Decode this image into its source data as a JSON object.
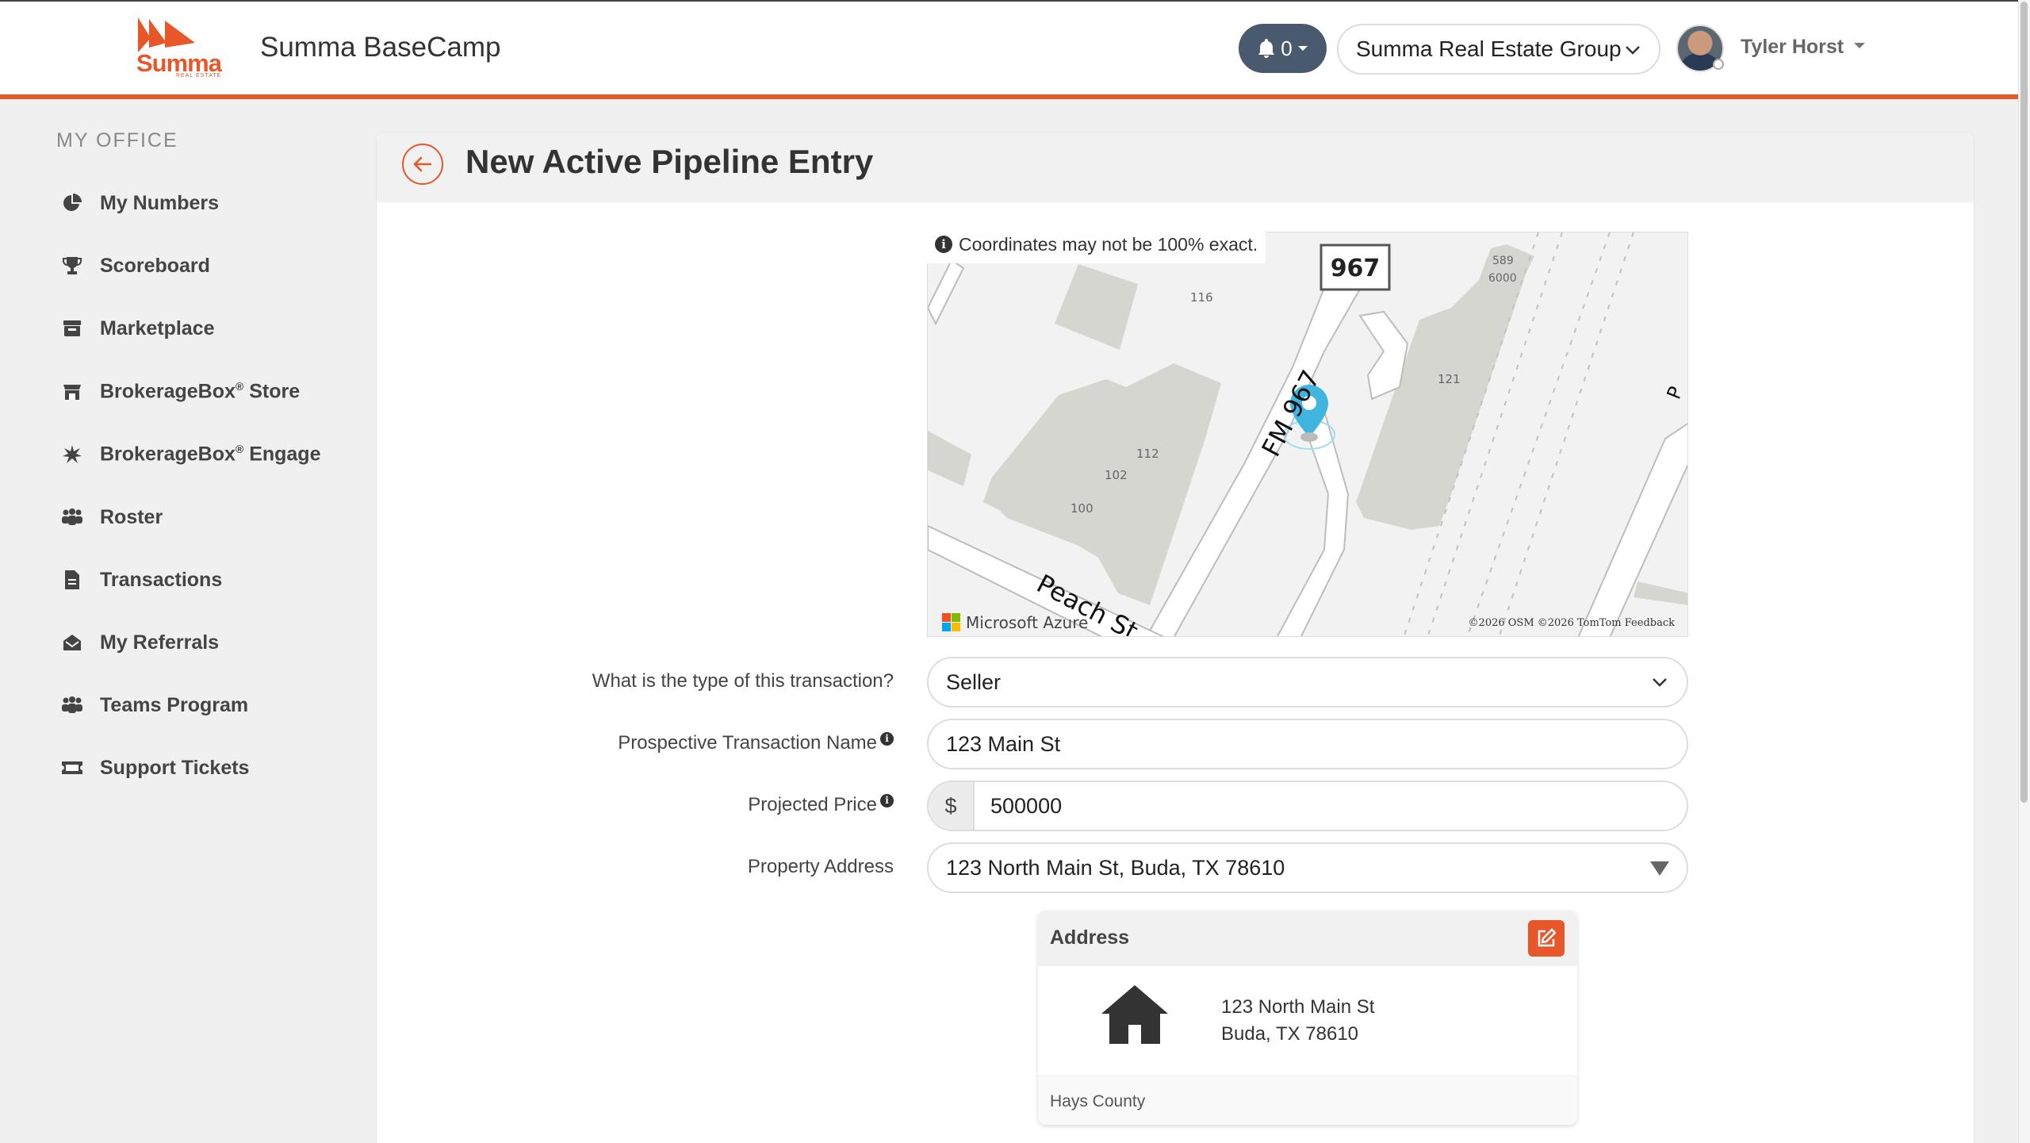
{
  "header": {
    "logo_word": "Summa",
    "logo_sub": "REAL ESTATE",
    "app_title": "Summa BaseCamp",
    "notification_count": "0",
    "org_name": "Summa Real Estate Group",
    "user_name": "Tyler Horst"
  },
  "sidebar": {
    "heading": "MY OFFICE",
    "items": [
      {
        "label": "My Numbers",
        "icon": "pie-chart-icon"
      },
      {
        "label": "Scoreboard",
        "icon": "trophy-icon"
      },
      {
        "label": "Marketplace",
        "icon": "store-icon"
      },
      {
        "label": "BrokerageBox",
        "suffix": "Store",
        "icon": "storefront-icon"
      },
      {
        "label": "BrokerageBox",
        "suffix": "Engage",
        "icon": "burst-icon"
      },
      {
        "label": "Roster",
        "icon": "people-icon"
      },
      {
        "label": "Transactions",
        "icon": "document-icon"
      },
      {
        "label": "My Referrals",
        "icon": "envelope-open-icon"
      },
      {
        "label": "Teams Program",
        "icon": "people-icon"
      },
      {
        "label": "Support Tickets",
        "icon": "ticket-icon"
      }
    ],
    "registered_mark": "®"
  },
  "page": {
    "title": "New Active Pipeline Entry"
  },
  "map": {
    "note": "Coordinates may not be 100% exact.",
    "route_shield": "967",
    "road_fm": "FM 967",
    "road_peach": "Peach St",
    "building_labels": [
      "116",
      "112",
      "102",
      "100",
      "121",
      "589",
      "6000"
    ],
    "provider": "Microsoft Azure",
    "copyright": "©2026 OSM  ©2026 TomTom  Feedback"
  },
  "form": {
    "type_label": "What is the type of this transaction?",
    "type_value": "Seller",
    "name_label": "Prospective Transaction Name",
    "name_value": "123 Main St",
    "price_label": "Projected Price",
    "currency": "$",
    "price_value": "500000",
    "address_label": "Property Address",
    "address_value": "123 North Main St, Buda, TX 78610"
  },
  "address_card": {
    "title": "Address",
    "line1": "123 North Main St",
    "line2": "Buda, TX 78610",
    "county": "Hays County"
  },
  "colors": {
    "accent": "#e8572a",
    "notif_bg": "#4a5a6e",
    "map_pin": "#3fb5e0"
  }
}
